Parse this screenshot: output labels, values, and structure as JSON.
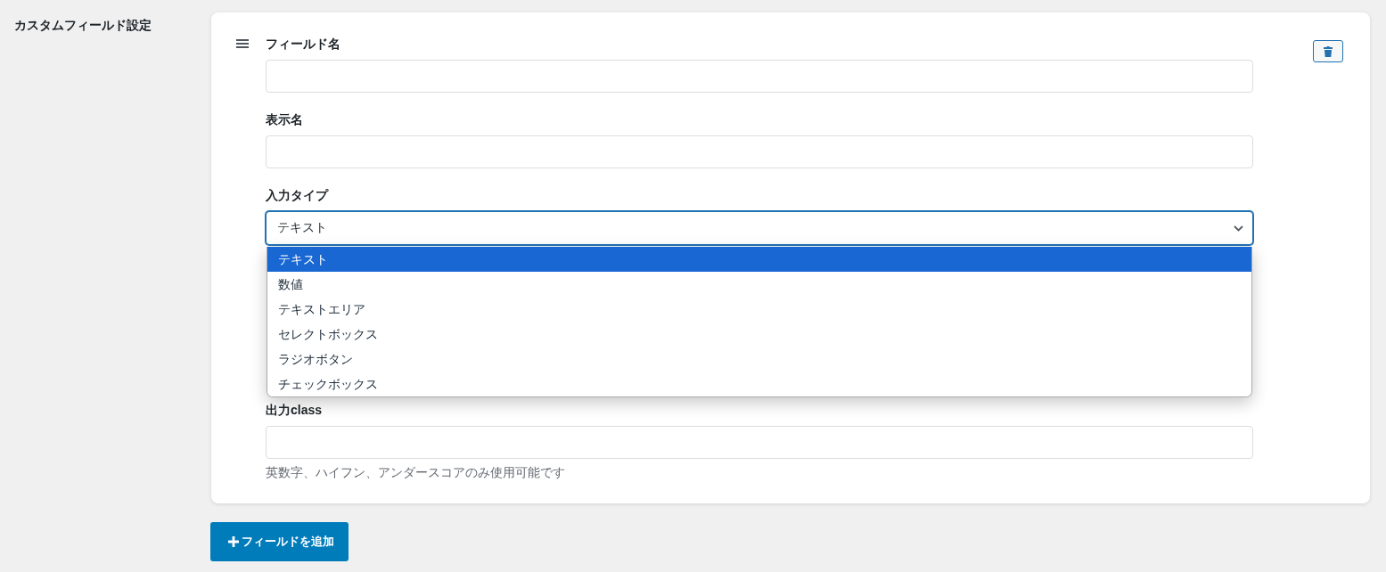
{
  "section": {
    "title": "カスタムフィールド設定"
  },
  "field_card": {
    "fields": [
      {
        "label": "フィールド名",
        "kind": "input"
      },
      {
        "label": "表示名",
        "kind": "input"
      },
      {
        "label": "入力タイプ",
        "kind": "select",
        "value": "テキスト",
        "expanded": true,
        "options": [
          {
            "label": "テキスト",
            "selected": true
          },
          {
            "label": "数値",
            "selected": false
          },
          {
            "label": "テキストエリア",
            "selected": false
          },
          {
            "label": "セレクトボックス",
            "selected": false
          },
          {
            "label": "ラジオボタン",
            "selected": false
          },
          {
            "label": "チェックボックス",
            "selected": false
          }
        ]
      },
      {
        "label": "出力class",
        "kind": "input",
        "help": "英数字、ハイフン、アンダースコアのみ使用可能です"
      }
    ]
  },
  "add_button": {
    "label": "フィールドを追加"
  }
}
